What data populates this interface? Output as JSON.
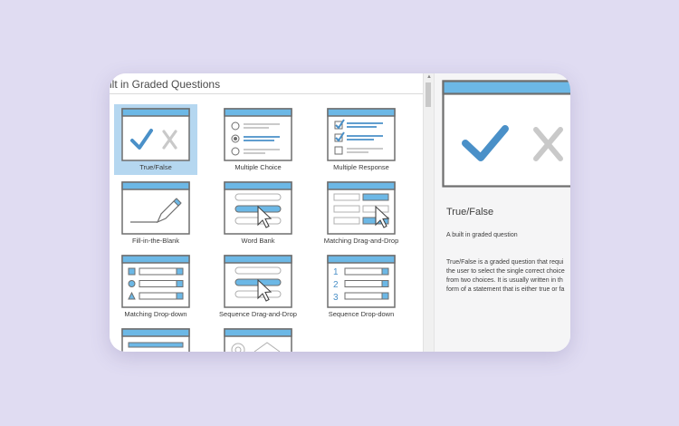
{
  "panel": {
    "title": "ilt in Graded Questions"
  },
  "tiles": [
    {
      "label": "True/False",
      "icon": "true-false-icon",
      "selected": true
    },
    {
      "label": "Multiple Choice",
      "icon": "multiple-choice-icon"
    },
    {
      "label": "Multiple Response",
      "icon": "multiple-response-icon"
    },
    {
      "label": "Fill-in-the-Blank",
      "icon": "fill-in-the-blank-icon"
    },
    {
      "label": "Word Bank",
      "icon": "word-bank-icon"
    },
    {
      "label": "Matching Drag-and-Drop",
      "icon": "matching-drag-and-drop-icon"
    },
    {
      "label": "Matching Drop-down",
      "icon": "matching-drop-down-icon"
    },
    {
      "label": "Sequence Drag-and-Drop",
      "icon": "sequence-drag-and-drop-icon"
    },
    {
      "label": "Sequence Drop-down",
      "icon": "sequence-drop-down-icon"
    }
  ],
  "preview": {
    "title": "True/False",
    "subtitle": "A built in graded question",
    "description_lines": [
      "True/False is a graded question that requi",
      "the user to select the single correct choice",
      "from two choices.  It is usually written in th",
      "form of a statement that is either true or fa"
    ]
  },
  "colors": {
    "accent_blue": "#6cb8e6",
    "check_blue": "#4a90c8",
    "frame_gray": "#6e6e6e",
    "selection": "#b5d7f0",
    "background": "#e0dcf2"
  }
}
